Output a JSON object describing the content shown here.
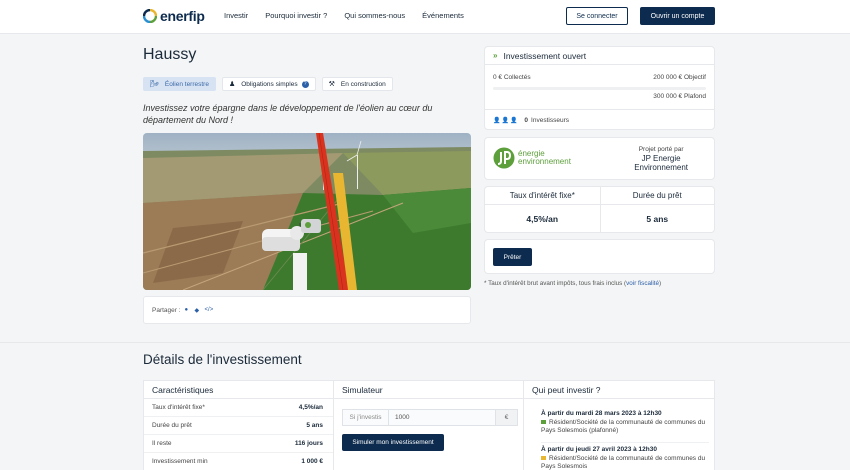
{
  "header": {
    "brand": "enerfip",
    "nav": [
      "Investir",
      "Pourquoi investir ?",
      "Qui sommes-nous",
      "Événements"
    ],
    "login_label": "Se connecter",
    "signup_label": "Ouvrir un compte"
  },
  "project": {
    "title": "Haussy",
    "tags": [
      {
        "label": "Éolien terrestre",
        "icon": "wind-turbine-icon",
        "active": true
      },
      {
        "label": "Obligations simples",
        "icon": "coin-icon",
        "active": false
      },
      {
        "label": "En construction",
        "icon": "hammer-icon",
        "active": false
      }
    ],
    "tagline": "Investissez votre épargne dans le développement de l'éolien au cœur du département du Nord !",
    "share_label": "Partager :"
  },
  "investment": {
    "status": "Investissement ouvert",
    "collected": "0 € Collectés",
    "objective": "200 000 € Objectif",
    "ceiling": "300 000 € Plafond",
    "progress_fraction": 0,
    "investors_count": "0",
    "investors_label": "Investisseurs"
  },
  "carrier": {
    "logo_line1": "énergie",
    "logo_line2": "environnement",
    "label": "Projet porté par",
    "name_line1": "JP Energie",
    "name_line2": "Environnement"
  },
  "rates": {
    "rate_label": "Taux d'intérêt fixe*",
    "rate_value": "4,5%/an",
    "duration_label": "Durée du prêt",
    "duration_value": "5 ans"
  },
  "lend_label": "Prêter",
  "footnote": {
    "text": "* Taux d'intérêt brut avant impôts, tous frais inclus (",
    "link": "voir fiscalité",
    "end": ")"
  },
  "details": {
    "title": "Détails de l'investissement",
    "characteristics": {
      "title": "Caractéristiques",
      "rows": [
        {
          "k": "Taux d'intérêt fixe*",
          "v": "4,5%/an"
        },
        {
          "k": "Durée du prêt",
          "v": "5 ans"
        },
        {
          "k": "Il reste",
          "v": "116 jours"
        },
        {
          "k": "Investissement min",
          "v": "1 000 €"
        }
      ]
    },
    "simulator": {
      "title": "Simulateur",
      "prefix": "Si j'investis",
      "value": "1000",
      "suffix": "€",
      "button": "Simuler mon investissement"
    },
    "who": {
      "title": "Qui peut investir ?",
      "entries": [
        {
          "date": "À partir du mardi 28 mars 2023 à 12h30",
          "text": "Résident/Société de la communauté de communes du Pays Solesmois (plafonné)",
          "color": "#5c9f3b"
        },
        {
          "date": "À partir du jeudi 27 avril 2023 à 12h30",
          "text": "Résident/Société de la communauté de communes du Pays Solesmois",
          "color": "#e8b630"
        }
      ]
    }
  },
  "colors": {
    "navy": "#0d2b4e",
    "green": "#5c9f3b",
    "accent_blue": "#2b5fa8"
  }
}
